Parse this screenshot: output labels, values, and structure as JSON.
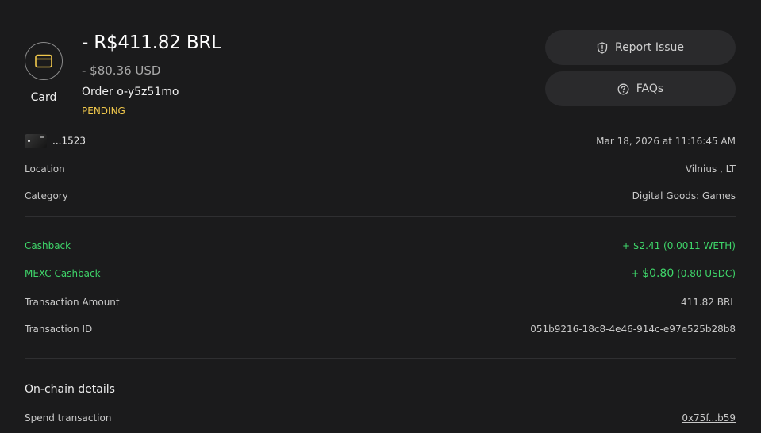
{
  "header": {
    "method_label": "Card",
    "amount": "- R$411.82 BRL",
    "amount_usd": "- $80.36 USD",
    "order": "Order o-y5z51mo",
    "status": "PENDING"
  },
  "actions": {
    "report_label": "Report Issue",
    "faq_label": "FAQs"
  },
  "details": {
    "card_last4": "...1523",
    "datetime": "Mar 18, 2026 at 11:16:45 AM",
    "location_label": "Location",
    "location_value": "Vilnius , LT",
    "category_label": "Category",
    "category_value": "Digital Goods: Games"
  },
  "rewards": {
    "cashback_label": "Cashback",
    "cashback_value": "+ $2.41 (0.0011 WETH)",
    "mexc_label": "MEXC Cashback",
    "mexc_value_prefix": "+ ",
    "mexc_value_main": "$0.80",
    "mexc_value_sub": " (0.80 USDC)",
    "txn_amount_label": "Transaction Amount",
    "txn_amount_value": "411.82 BRL",
    "txn_id_label": "Transaction ID",
    "txn_id_value": "051b9216-18c8-4e46-914c-e97e525b28b8"
  },
  "onchain": {
    "title": "On-chain details",
    "spend_label": "Spend transaction",
    "spend_value": "0x75f...b59"
  },
  "colors": {
    "background": "#1b1b1c",
    "pending": "#f2c94c",
    "positive": "#3fd66a",
    "button_bg": "#2a2a2c"
  },
  "icons": {
    "method": "credit-card-icon",
    "report": "shield-alert-icon",
    "faq": "help-circle-icon"
  }
}
